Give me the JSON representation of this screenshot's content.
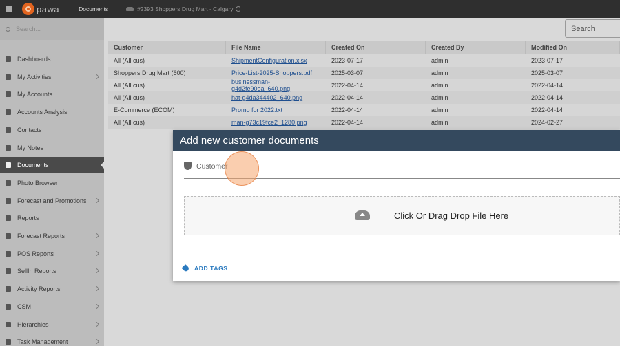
{
  "topbar": {
    "logo_text": "pawa",
    "nav_label": "Documents",
    "store_label": "#2393 Shoppers Drug Mart - Calgary"
  },
  "sidebar": {
    "search_placeholder": "Search...",
    "items": [
      {
        "label": "Dashboards",
        "has_chevron": false,
        "active": false
      },
      {
        "label": "My Activities",
        "has_chevron": true,
        "active": false
      },
      {
        "label": "My Accounts",
        "has_chevron": false,
        "active": false
      },
      {
        "label": "Accounts Analysis",
        "has_chevron": false,
        "active": false
      },
      {
        "label": "Contacts",
        "has_chevron": false,
        "active": false
      },
      {
        "label": "My Notes",
        "has_chevron": false,
        "active": false
      },
      {
        "label": "Documents",
        "has_chevron": false,
        "active": true
      },
      {
        "label": "Photo Browser",
        "has_chevron": false,
        "active": false
      },
      {
        "label": "Forecast and Promotions",
        "has_chevron": true,
        "active": false
      },
      {
        "label": "Reports",
        "has_chevron": false,
        "active": false
      },
      {
        "label": "Forecast Reports",
        "has_chevron": true,
        "active": false
      },
      {
        "label": "POS Reports",
        "has_chevron": true,
        "active": false
      },
      {
        "label": "SellIn Reports",
        "has_chevron": true,
        "active": false
      },
      {
        "label": "Activity Reports",
        "has_chevron": true,
        "active": false
      },
      {
        "label": "CSM",
        "has_chevron": true,
        "active": false
      },
      {
        "label": "Hierarchies",
        "has_chevron": true,
        "active": false
      },
      {
        "label": "Task Management",
        "has_chevron": true,
        "active": false
      }
    ]
  },
  "main": {
    "search_placeholder": "Search",
    "table": {
      "headers": [
        "Customer",
        "File Name",
        "Created On",
        "Created By",
        "Modified On"
      ],
      "rows": [
        [
          "All (All cus)",
          "ShipmentConfiguration.xlsx",
          "2023-07-17",
          "admin",
          "2023-07-17"
        ],
        [
          "Shoppers Drug Mart (600)",
          "Price-List-2025-Shoppers.pdf",
          "2025-03-07",
          "admin",
          "2025-03-07"
        ],
        [
          "All (All cus)",
          "businessman-g4d2fe90ea_640.png",
          "2022-04-14",
          "admin",
          "2022-04-14"
        ],
        [
          "All (All cus)",
          "hat-g4da344402_640.png",
          "2022-04-14",
          "admin",
          "2022-04-14"
        ],
        [
          "E-Commerce (ECOM)",
          "Promo for 2022.txt",
          "2022-04-14",
          "admin",
          "2022-04-14"
        ],
        [
          "All (All cus)",
          "man-g73c19fce2_1280.png",
          "2022-04-14",
          "admin",
          "2024-02-27"
        ]
      ]
    }
  },
  "modal": {
    "title": "Add new customer documents",
    "customer_label": "Customer",
    "drop_text": "Click Or Drag Drop File Here",
    "add_tags_label": "ADD TAGS"
  },
  "icons": {
    "menu": "menu-icon",
    "search": "search-icon",
    "shield": "shield-icon",
    "cloud_upload": "cloud-upload-icon",
    "tag": "tag-icon"
  }
}
